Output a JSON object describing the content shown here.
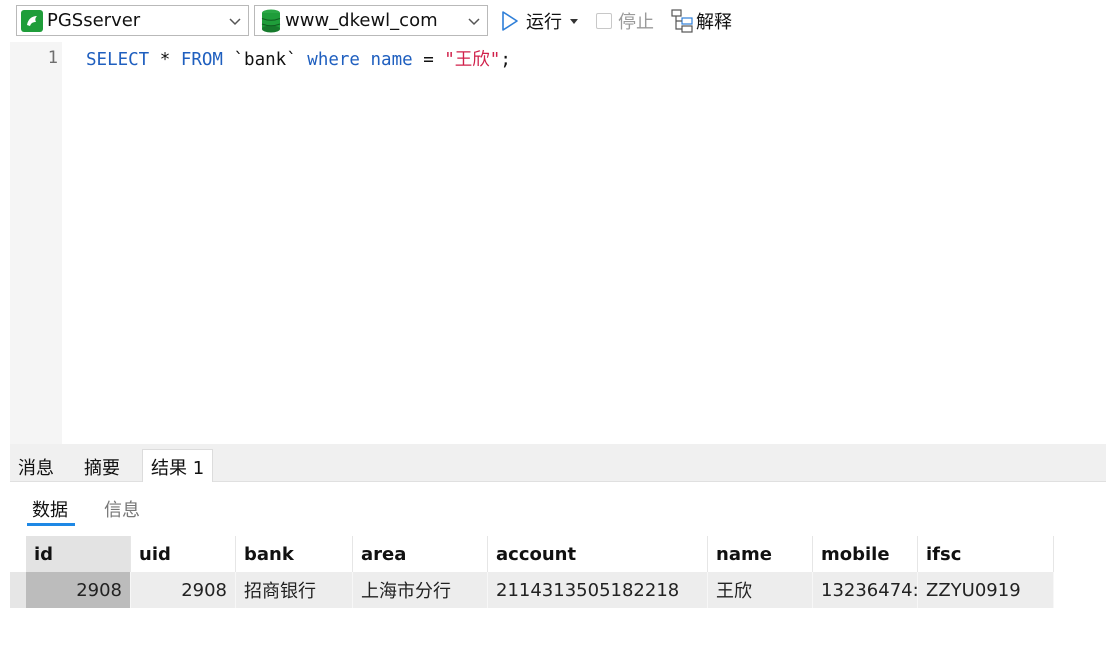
{
  "toolbar": {
    "connection": "PGSserver",
    "database": "www_dkewl_com",
    "run_label": "运行",
    "stop_label": "停止",
    "explain_label": "解释"
  },
  "editor": {
    "line_number": "1",
    "tokens": {
      "select": "SELECT",
      "star": " * ",
      "from": "FROM",
      "table": " `bank` ",
      "where": "where",
      "name": " name",
      "eq": " = ",
      "value": "\"王欣\"",
      "semi": ";"
    }
  },
  "result_tabs": [
    "消息",
    "摘要",
    "结果 1"
  ],
  "sub_tabs": [
    "数据",
    "信息"
  ],
  "table": {
    "columns": [
      "id",
      "uid",
      "bank",
      "area",
      "account",
      "name",
      "mobile",
      "ifsc"
    ],
    "rows": [
      [
        "2908",
        "2908",
        "招商银行",
        "上海市分行",
        "2114313505182218",
        "王欣",
        "13236474:",
        "ZZYU0919"
      ]
    ]
  },
  "colors": {
    "keyword": "#1f5fbf",
    "string": "#d0204a",
    "accent": "#1e88e5",
    "server_icon": "#1f9d3a",
    "db_icon": "#1f9d3a"
  },
  "icons": {
    "server": "server-dolphin-icon",
    "database": "database-cylinder-icon",
    "run": "play-outline-icon",
    "stop": "stop-square-icon",
    "explain": "explain-tree-icon"
  }
}
